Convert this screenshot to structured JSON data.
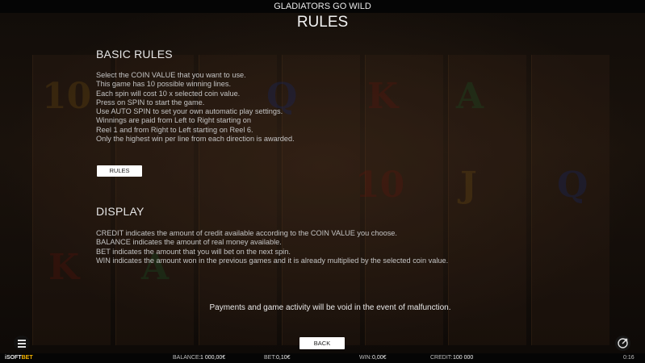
{
  "window": {
    "title": "GLADIATORS GO WILD"
  },
  "page": {
    "title": "RULES"
  },
  "basic_rules": {
    "heading": "BASIC RULES",
    "lines": [
      "Select the COIN VALUE that you want to use.",
      "This game has 10 possible winning lines.",
      "Each spin will cost 10 x selected coin value.",
      "Press on SPIN to start the game.",
      "Use AUTO SPIN to set your own automatic play settings.",
      "Winnings are paid from Left to Right starting on",
      "Reel 1 and from Right to Left starting on Reel 6.",
      "Only the highest win per line from each direction is awarded."
    ],
    "button_label": "RULES"
  },
  "display": {
    "heading": "DISPLAY",
    "lines": [
      "CREDIT indicates the amount of credit available according to the COIN VALUE you choose.",
      "BALANCE indicates the amount of real money available.",
      "BET indicates the amount that you will bet on the next spin.",
      "WIN indicates the amount won in the previous games and it is already multiplied by the selected coin value."
    ]
  },
  "disclaimer": "Payments and game activity will be void in the event of malfunction.",
  "footer": {
    "back_label": "BACK",
    "menu_icon": "menu-icon",
    "exit_icon": "exit-icon"
  },
  "status_bar": {
    "brand_prefix": "iSOFT",
    "brand_suffix": "BET",
    "balance_label": "BALANCE:",
    "balance_value": "1 000,00€",
    "bet_label": "BET:",
    "bet_value": "0,10€",
    "win_label": "WIN:",
    "win_value": "0,00€",
    "credit_label": "CREDIT:",
    "credit_value": "100 000",
    "clock": "0:16"
  },
  "colors": {
    "brand_accent": "#f5b400",
    "button_bg": "#ffffff",
    "bar_bg": "#050505"
  }
}
